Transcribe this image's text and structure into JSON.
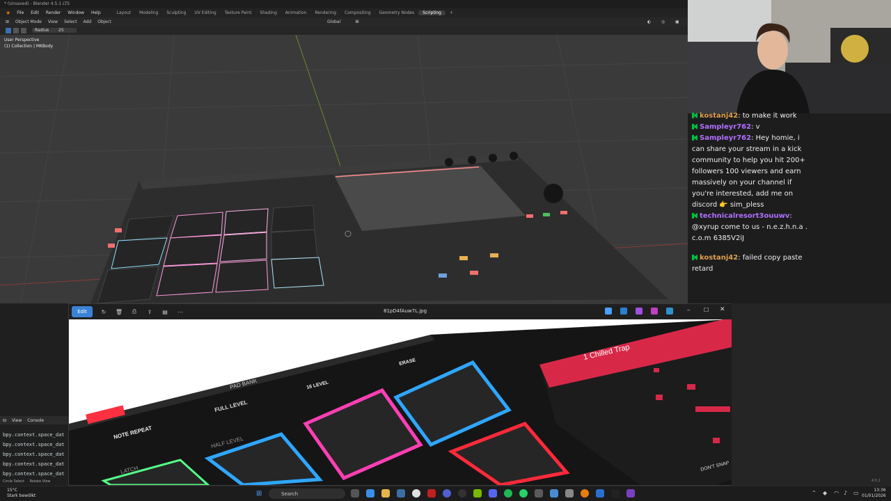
{
  "blender": {
    "title": "* (Unsaved) - Blender 4.5.1 LTS",
    "menus": [
      "File",
      "Edit",
      "Render",
      "Window",
      "Help"
    ],
    "workspaces": [
      "Layout",
      "Modeling",
      "Sculpting",
      "UV Editing",
      "Texture Paint",
      "Shading",
      "Animation",
      "Rendering",
      "Compositing",
      "Geometry Nodes",
      "Scripting"
    ],
    "active_workspace": "Scripting",
    "header": {
      "mode": "Object Mode",
      "view": "View",
      "select": "Select",
      "add": "Add",
      "object": "Object",
      "orientation": "Global"
    },
    "tool": {
      "radius_label": "Radius",
      "radius_value": "25"
    },
    "viewport": {
      "perspective": "User Perspective",
      "collection": "(1) Collection | MKBody"
    },
    "console": {
      "menu_view": "View",
      "menu_console": "Console",
      "lines": [
        "bpy.context.space_dat",
        "bpy.context.space_dat",
        "bpy.context.space_dat",
        "bpy.context.space_dat",
        "bpy.context.space_dat"
      ]
    },
    "status": {
      "left": "Circle Select",
      "right": "Rotate View",
      "version": "4.5.1"
    }
  },
  "chat": {
    "messages": [
      {
        "user": "kostanj42",
        "color": "#e0a050",
        "text": "to make it work"
      },
      {
        "user": "Sampleyr762",
        "color": "#b070ff",
        "text": "v"
      },
      {
        "user": "Sampleyr762",
        "color": "#b070ff",
        "text": "Hey homie, i can share your stream in a kick community to help you hit 200+ followers 100 viewers and earn massively on your channel if you're interested, add me on discord 👉 sim_pless"
      },
      {
        "user": "technicalresort3ouuwv",
        "color": "#b070ff",
        "text": "@xyrup come to us - n.e.z.h.n.a . c.o.m 6385V2iJ"
      },
      {
        "user": "kostanj42",
        "color": "#e0a050",
        "text": "failed copy paste retard"
      }
    ]
  },
  "photos": {
    "edit_label": "Edit",
    "filename": "81pD4fAuw7L.jpg",
    "image_labels": {
      "pad_bank": "PAD BANK",
      "full_level": "FULL LEVEL",
      "level16": "16 LEVEL",
      "erase": "ERASE",
      "note_repeat": "NOTE REPEAT",
      "half_level": "HALF LEVEL",
      "latch": "LATCH",
      "track": "1 Chilled Trap",
      "dont_snap": "DON'T SNAP"
    }
  },
  "taskbar": {
    "weather_temp": "15°C",
    "weather_desc": "Stark bewölkt",
    "search_placeholder": "Search",
    "time": "13:36",
    "date": "01/01/2026"
  },
  "colors": {
    "accent": "#3b82d6",
    "blender_active": "#3d3d3d",
    "pad_blue": "#2fa6ff",
    "pad_pink": "#ff3fb4",
    "pad_red": "#ff2a3a"
  }
}
